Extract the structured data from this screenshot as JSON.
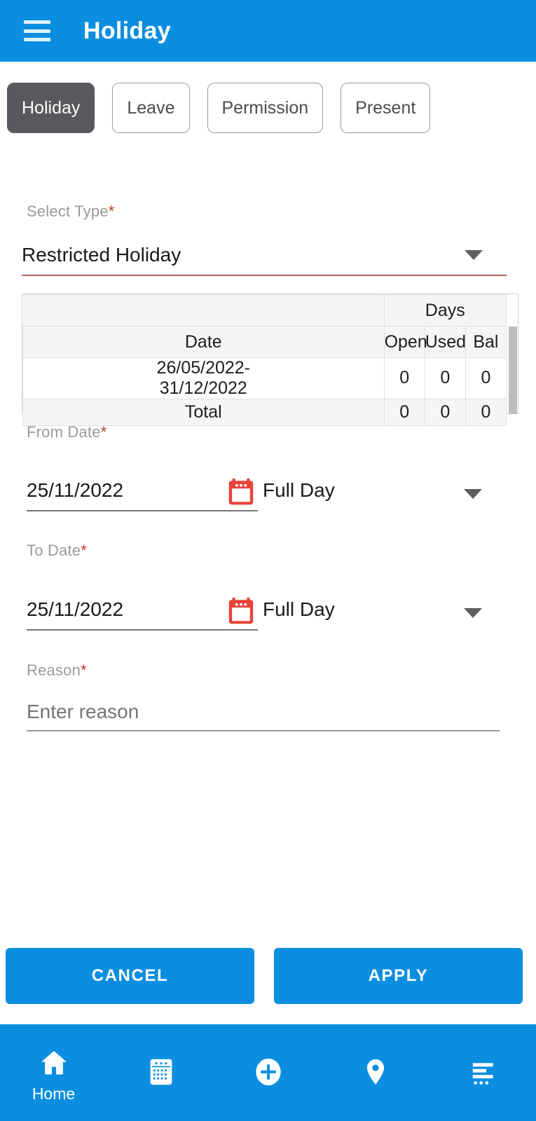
{
  "appbar": {
    "menu_icon": "hamburger-menu-icon",
    "title": "Holiday"
  },
  "tabs": [
    {
      "label": "Holiday",
      "active": true
    },
    {
      "label": "Leave",
      "active": false
    },
    {
      "label": "Permission",
      "active": false
    },
    {
      "label": "Present",
      "active": false
    }
  ],
  "form": {
    "select_type": {
      "label": "Select Type",
      "required_mark": "*",
      "value": "Restricted Holiday",
      "caret_icon": "chevron-down-icon",
      "underline_color": "#b5625a"
    },
    "from_date": {
      "label": "From Date",
      "required_mark": "*",
      "value": "25/11/2022",
      "calendar_icon": "calendar-icon",
      "duration": "Full Day",
      "caret_icon": "chevron-down-icon"
    },
    "to_date": {
      "label": "To Date",
      "required_mark": "*",
      "value": "25/11/2022",
      "calendar_icon": "calendar-icon",
      "duration": "Full Day",
      "caret_icon": "chevron-down-icon"
    },
    "reason": {
      "label": "Reason",
      "required_mark": "*",
      "value": "",
      "placeholder": "Enter reason"
    }
  },
  "balance_table": {
    "group_header": "Days",
    "columns": [
      "Date",
      "Open",
      "Used",
      "Bal"
    ],
    "rows": [
      {
        "date": "26/05/2022-31/12/2022",
        "date_line1": "26/05/2022-",
        "date_line2": "31/12/2022",
        "open": "0",
        "used": "0",
        "bal": "0"
      }
    ],
    "total": {
      "label": "Total",
      "open": "0",
      "used": "0",
      "bal": "0"
    },
    "total_color": "#2d8fd0",
    "has_vertical_scrollbar": true
  },
  "actions": {
    "cancel_label": "CANCEL",
    "apply_label": "APPLY",
    "button_color": "#0b8ee0"
  },
  "bottom_nav": {
    "items": [
      {
        "icon": "home-icon",
        "label": "Home",
        "active": true
      },
      {
        "icon": "calendar-grid-icon",
        "label": "",
        "active": false
      },
      {
        "icon": "plus-circle-icon",
        "label": "",
        "active": false
      },
      {
        "icon": "location-pin-icon",
        "label": "",
        "active": false
      },
      {
        "icon": "list-more-icon",
        "label": "",
        "active": false
      }
    ],
    "background": "#0b8ee0"
  },
  "theme": {
    "primary": "#0b8ee0",
    "active_pill": "#5a585c",
    "required_red": "#c0392b",
    "calendar_red": "#e8433a",
    "link_blue": "#2d8fd0"
  }
}
